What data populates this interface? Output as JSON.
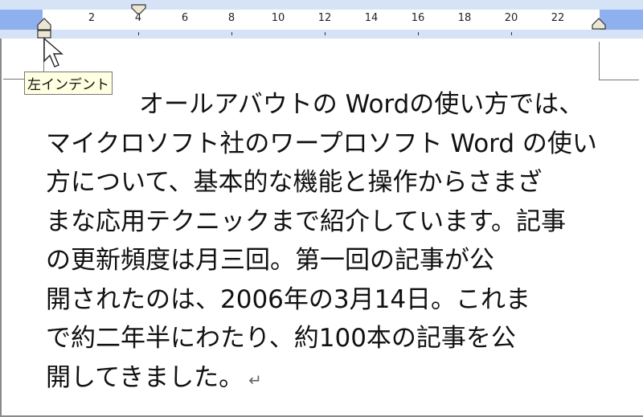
{
  "ruler": {
    "numbers": [
      "2",
      "4",
      "6",
      "8",
      "10",
      "12",
      "14",
      "16",
      "18",
      "20",
      "22"
    ]
  },
  "tooltip": "左インデント",
  "document": {
    "lines": [
      "オールアバウトの Wordの使い方では、",
      "マイクロソフト社のワープロソフト Word の使い",
      "方について、基本的な機能と操作からさまざ",
      "まな応用テクニックまで紹介しています。記事",
      "の更新頻度は月三回。第一回の記事が公",
      "開されたのは、2006年の3月14日。これま",
      "で約二年半にわたり、約100本の記事を公",
      "開してきました。"
    ],
    "paragraph_mark": "↵"
  }
}
